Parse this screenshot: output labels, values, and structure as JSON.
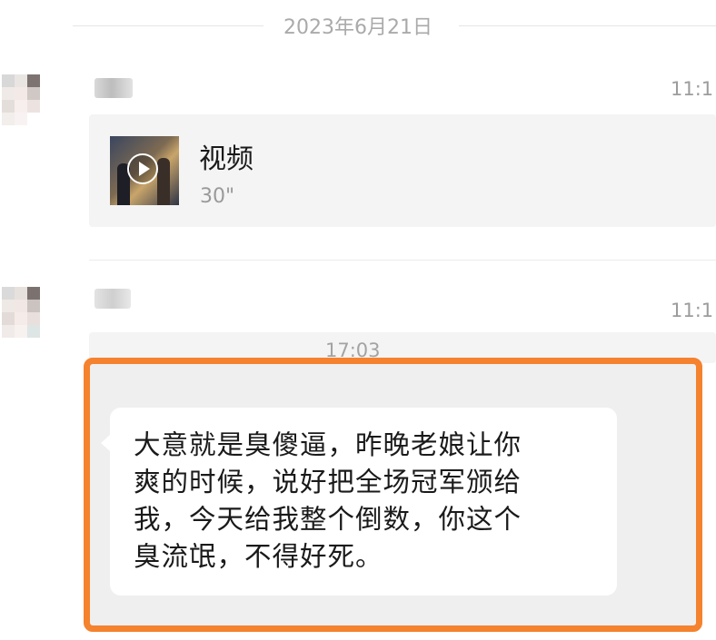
{
  "chat": {
    "date_divider": "2023年6月21日",
    "messages": [
      {
        "time": "11:1",
        "video": {
          "title": "视频",
          "duration": "30\""
        }
      },
      {
        "time": "11:1",
        "quoted_time": "17:03",
        "text_lines": [
          "大意就是臭傻逼，昨晚老娘让你",
          "爽的时候，说好把全场冠军颁给",
          "我，今天给我整个倒数，你这个",
          "臭流氓，不得好死。"
        ]
      }
    ]
  },
  "colors": {
    "highlight_border": "#f5822e",
    "chat_background": "#f4f4f4",
    "bubble": "#ffffff"
  },
  "icons": [
    "play-icon"
  ]
}
